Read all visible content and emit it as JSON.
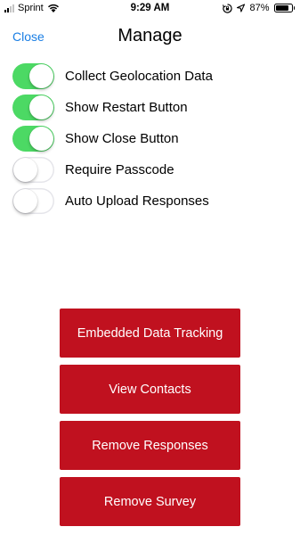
{
  "status_bar": {
    "carrier": "Sprint",
    "time": "9:29 AM",
    "battery_percent": "87%",
    "battery_level": 0.87,
    "icons": [
      "signal-icon",
      "wifi-icon",
      "rotation-lock-icon",
      "location-icon",
      "battery-icon"
    ]
  },
  "nav": {
    "close_label": "Close",
    "title": "Manage"
  },
  "settings": {
    "items": [
      {
        "label": "Collect Geolocation Data",
        "on": true
      },
      {
        "label": "Show Restart Button",
        "on": true
      },
      {
        "label": "Show Close Button",
        "on": true
      },
      {
        "label": "Require Passcode",
        "on": false
      },
      {
        "label": "Auto Upload Responses",
        "on": false
      }
    ]
  },
  "actions": {
    "buttons": [
      {
        "label": "Embedded Data Tracking"
      },
      {
        "label": "View Contacts"
      },
      {
        "label": "Remove Responses"
      },
      {
        "label": "Remove Survey"
      }
    ]
  },
  "colors": {
    "accent_blue": "#1a7ee4",
    "toggle_on": "#4cd964",
    "button_red": "#c0111f"
  }
}
